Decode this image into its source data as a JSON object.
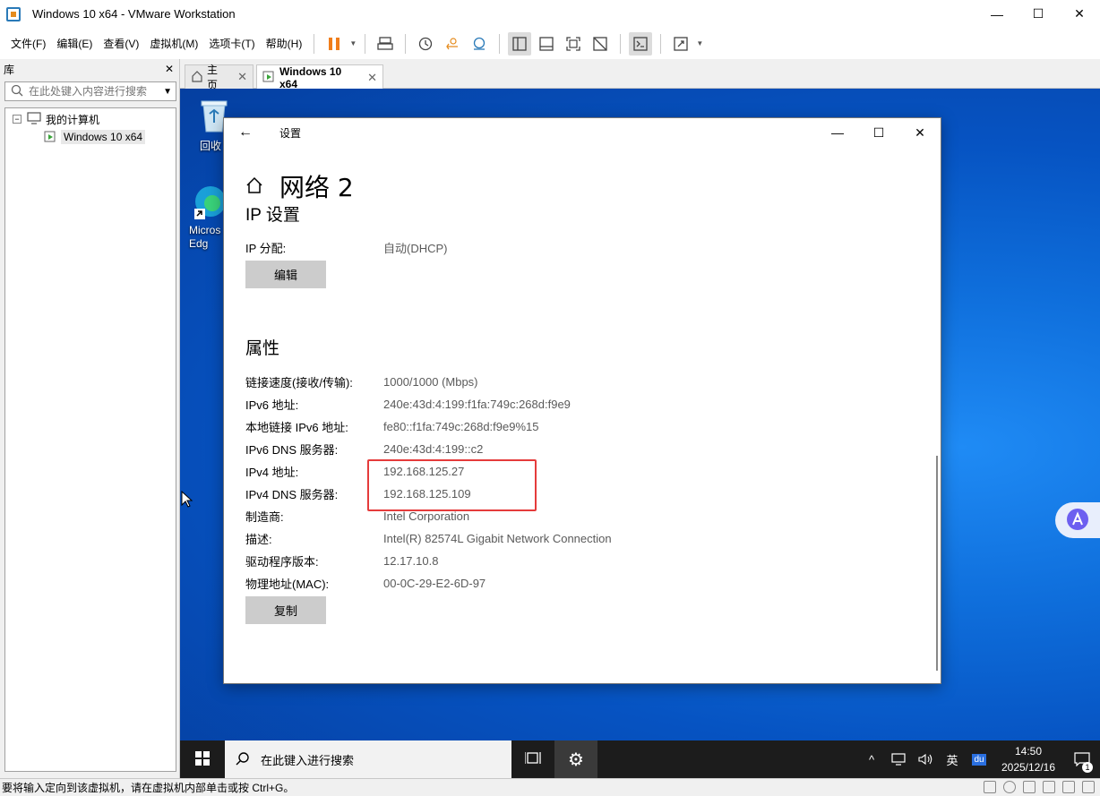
{
  "window": {
    "title": "Windows 10 x64 - VMware Workstation",
    "minimize": "—",
    "maximize": "☐",
    "close": "✕"
  },
  "menu": {
    "items": [
      "文件(F)",
      "编辑(E)",
      "查看(V)",
      "虚拟机(M)",
      "选项卡(T)",
      "帮助(H)"
    ]
  },
  "library": {
    "title": "库",
    "close": "✕",
    "search_placeholder": "在此处键入内容进行搜索",
    "tree": {
      "root": "我的计算机",
      "child": "Windows 10 x64"
    }
  },
  "tabs": [
    {
      "label": "主页",
      "close": "✕"
    },
    {
      "label": "Windows 10 x64",
      "close": "✕"
    }
  ],
  "desktop": {
    "icons": [
      {
        "label": "回收"
      },
      {
        "label": "Micros Edg"
      }
    ]
  },
  "settings": {
    "back": "←",
    "title": "设置",
    "minimize": "—",
    "maximize": "☐",
    "close": "✕",
    "page_title": "网络 2",
    "ip_section": "IP 设置",
    "ip_assign_label": "IP 分配:",
    "ip_assign_value": "自动(DHCP)",
    "edit_button": "编辑",
    "props_section": "属性",
    "properties": [
      {
        "k": "链接速度(接收/传输):",
        "v": "1000/1000 (Mbps)"
      },
      {
        "k": "IPv6 地址:",
        "v": "240e:43d:4:199:f1fa:749c:268d:f9e9"
      },
      {
        "k": "本地链接 IPv6 地址:",
        "v": "fe80::f1fa:749c:268d:f9e9%15"
      },
      {
        "k": "IPv6 DNS 服务器:",
        "v": "240e:43d:4:199::c2"
      },
      {
        "k": "IPv4 地址:",
        "v": "192.168.125.27"
      },
      {
        "k": "IPv4 DNS 服务器:",
        "v": "192.168.125.109"
      },
      {
        "k": "制造商:",
        "v": "Intel Corporation"
      },
      {
        "k": "描述:",
        "v": "Intel(R) 82574L Gigabit Network Connection"
      },
      {
        "k": "驱动程序版本:",
        "v": "12.17.10.8"
      },
      {
        "k": "物理地址(MAC):",
        "v": "00-0C-29-E2-6D-97"
      }
    ],
    "copy_button": "复制"
  },
  "taskbar": {
    "search_placeholder": "在此键入进行搜索",
    "tray": {
      "chevron": "^",
      "volume": "🔊",
      "ime": "英",
      "baidu": "du",
      "time": "14:50",
      "date": "2025/12/16",
      "notification_count": "1"
    }
  },
  "status": {
    "text": "要将输入定向到该虚拟机，请在虚拟机内部单击或按 Ctrl+G。"
  },
  "colors": {
    "highlight_box": "#e53b3b",
    "desktop_blue": "#0a5fd0",
    "taskbar": "#1c1c1c"
  }
}
